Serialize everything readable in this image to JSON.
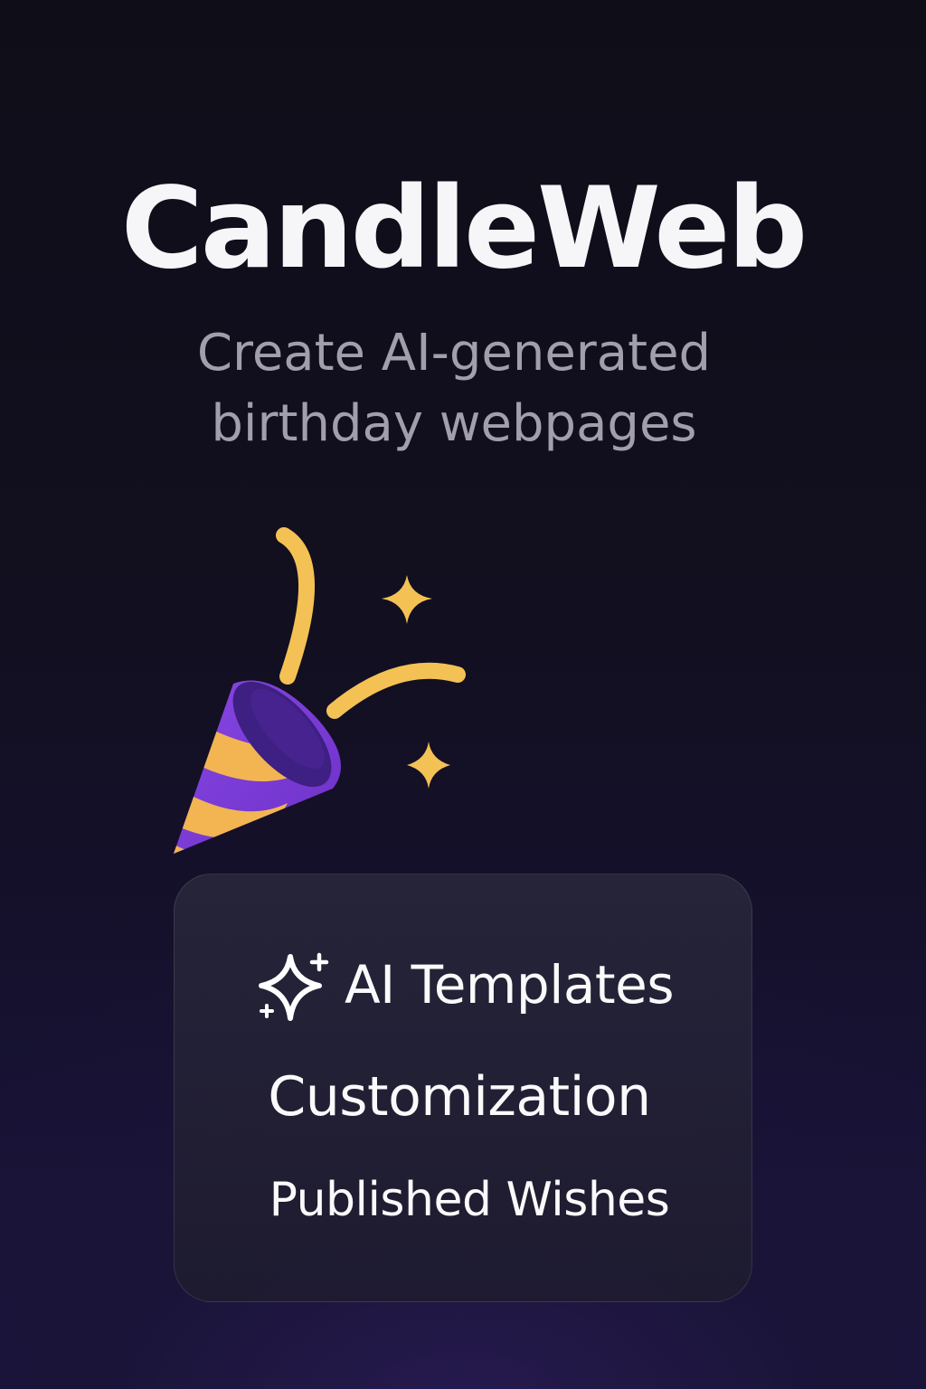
{
  "app": {
    "title": "CandleWeb",
    "tagline_line1": "Create AI-generated",
    "tagline_line2": "birthday webpages"
  },
  "hero": {
    "icon": "party-popper-icon"
  },
  "features": {
    "items": [
      {
        "label": "AI Templates",
        "icon": "sparkles-icon"
      },
      {
        "label": "Customization"
      },
      {
        "label": "Published Wishes"
      }
    ]
  },
  "colors": {
    "background": "#110f1c",
    "accent_purple": "#7b3fd6",
    "accent_yellow": "#f4c155",
    "text_primary": "#f6f6f8",
    "text_secondary": "#a09fab"
  }
}
